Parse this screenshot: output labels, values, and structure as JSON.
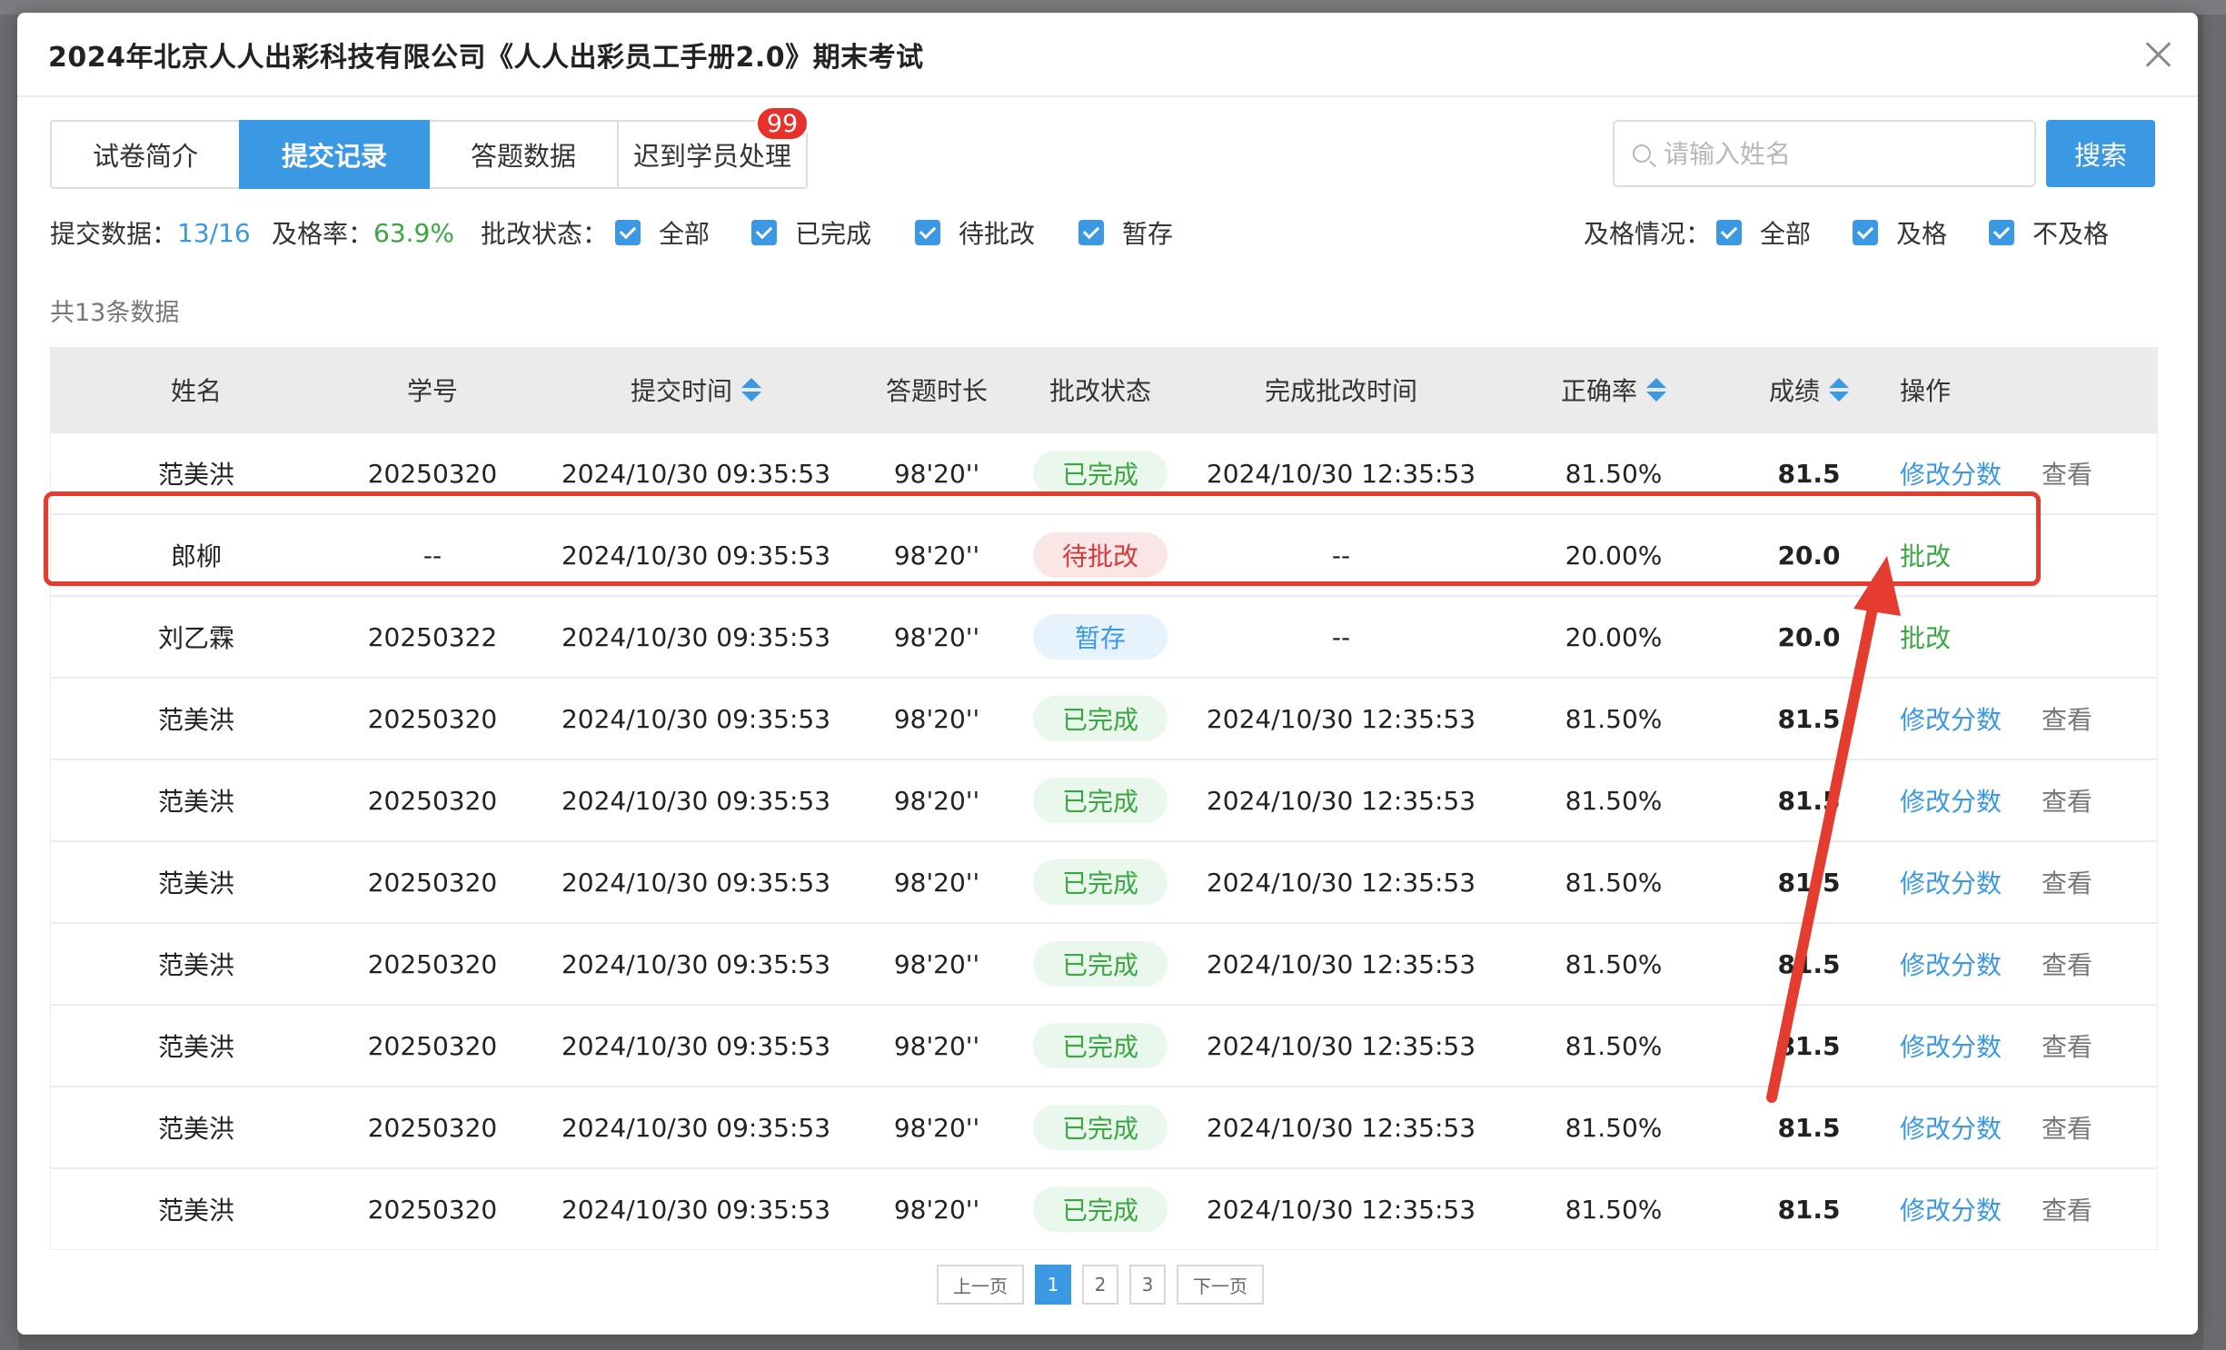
{
  "modal": {
    "title": "2024年北京人人出彩科技有限公司《人人出彩员工手册2.0》期末考试"
  },
  "tabs": [
    {
      "label": "试卷简介",
      "active": false
    },
    {
      "label": "提交记录",
      "active": true
    },
    {
      "label": "答题数据",
      "active": false
    },
    {
      "label": "迟到学员处理",
      "active": false,
      "badge": "99"
    }
  ],
  "search": {
    "placeholder": "请输入姓名",
    "value": "",
    "button_label": "搜索"
  },
  "filters": {
    "submit_label": "提交数据：",
    "submit_value": "13/16",
    "pass_rate_label": "及格率：",
    "pass_rate_value": "63.9%",
    "review_status_label": "批改状态：",
    "review_status_options": [
      {
        "label": "全部",
        "checked": true
      },
      {
        "label": "已完成",
        "checked": true
      },
      {
        "label": "待批改",
        "checked": true
      },
      {
        "label": "暂存",
        "checked": true
      }
    ],
    "pass_status_label": "及格情况：",
    "pass_status_options": [
      {
        "label": "全部",
        "checked": true
      },
      {
        "label": "及格",
        "checked": true
      },
      {
        "label": "不及格",
        "checked": true
      }
    ]
  },
  "total_text": "共13条数据",
  "table": {
    "headers": {
      "name": "姓名",
      "id": "学号",
      "submit_time": "提交时间",
      "duration": "答题时长",
      "review_status": "批改状态",
      "done_time": "完成批改时间",
      "accuracy": "正确率",
      "score": "成绩",
      "ops": "操作"
    },
    "rows": [
      {
        "name": "范美洪",
        "id": "20250320",
        "submit_time": "2024/10/30 09:35:53",
        "duration": "98'20''",
        "status": "已完成",
        "status_type": "done",
        "done_time": "2024/10/30 12:35:53",
        "accuracy": "81.50%",
        "score": "81.5",
        "ops": [
          {
            "label": "修改分数",
            "color": "blue"
          },
          {
            "label": "查看",
            "color": "gray"
          }
        ]
      },
      {
        "name": "郎柳",
        "id": "--",
        "submit_time": "2024/10/30 09:35:53",
        "duration": "98'20''",
        "status": "待批改",
        "status_type": "pending",
        "done_time": "--",
        "accuracy": "20.00%",
        "score": "20.0",
        "ops": [
          {
            "label": "批改",
            "color": "green"
          }
        ]
      },
      {
        "name": "刘乙霖",
        "id": "20250322",
        "submit_time": "2024/10/30 09:35:53",
        "duration": "98'20''",
        "status": "暂存",
        "status_type": "draft",
        "done_time": "--",
        "accuracy": "20.00%",
        "score": "20.0",
        "ops": [
          {
            "label": "批改",
            "color": "green"
          }
        ]
      },
      {
        "name": "范美洪",
        "id": "20250320",
        "submit_time": "2024/10/30 09:35:53",
        "duration": "98'20''",
        "status": "已完成",
        "status_type": "done",
        "done_time": "2024/10/30 12:35:53",
        "accuracy": "81.50%",
        "score": "81.5",
        "ops": [
          {
            "label": "修改分数",
            "color": "blue"
          },
          {
            "label": "查看",
            "color": "gray"
          }
        ]
      },
      {
        "name": "范美洪",
        "id": "20250320",
        "submit_time": "2024/10/30 09:35:53",
        "duration": "98'20''",
        "status": "已完成",
        "status_type": "done",
        "done_time": "2024/10/30 12:35:53",
        "accuracy": "81.50%",
        "score": "81.5",
        "ops": [
          {
            "label": "修改分数",
            "color": "blue"
          },
          {
            "label": "查看",
            "color": "gray"
          }
        ]
      },
      {
        "name": "范美洪",
        "id": "20250320",
        "submit_time": "2024/10/30 09:35:53",
        "duration": "98'20''",
        "status": "已完成",
        "status_type": "done",
        "done_time": "2024/10/30 12:35:53",
        "accuracy": "81.50%",
        "score": "81.5",
        "ops": [
          {
            "label": "修改分数",
            "color": "blue"
          },
          {
            "label": "查看",
            "color": "gray"
          }
        ]
      },
      {
        "name": "范美洪",
        "id": "20250320",
        "submit_time": "2024/10/30 09:35:53",
        "duration": "98'20''",
        "status": "已完成",
        "status_type": "done",
        "done_time": "2024/10/30 12:35:53",
        "accuracy": "81.50%",
        "score": "81.5",
        "ops": [
          {
            "label": "修改分数",
            "color": "blue"
          },
          {
            "label": "查看",
            "color": "gray"
          }
        ]
      },
      {
        "name": "范美洪",
        "id": "20250320",
        "submit_time": "2024/10/30 09:35:53",
        "duration": "98'20''",
        "status": "已完成",
        "status_type": "done",
        "done_time": "2024/10/30 12:35:53",
        "accuracy": "81.50%",
        "score": "81.5",
        "ops": [
          {
            "label": "修改分数",
            "color": "blue"
          },
          {
            "label": "查看",
            "color": "gray"
          }
        ]
      },
      {
        "name": "范美洪",
        "id": "20250320",
        "submit_time": "2024/10/30 09:35:53",
        "duration": "98'20''",
        "status": "已完成",
        "status_type": "done",
        "done_time": "2024/10/30 12:35:53",
        "accuracy": "81.50%",
        "score": "81.5",
        "ops": [
          {
            "label": "修改分数",
            "color": "blue"
          },
          {
            "label": "查看",
            "color": "gray"
          }
        ]
      },
      {
        "name": "范美洪",
        "id": "20250320",
        "submit_time": "2024/10/30 09:35:53",
        "duration": "98'20''",
        "status": "已完成",
        "status_type": "done",
        "done_time": "2024/10/30 12:35:53",
        "accuracy": "81.50%",
        "score": "81.5",
        "ops": [
          {
            "label": "修改分数",
            "color": "blue"
          },
          {
            "label": "查看",
            "color": "gray"
          }
        ]
      }
    ]
  },
  "pagination": {
    "prev_label": "上一页",
    "pages": [
      "1",
      "2",
      "3"
    ],
    "current_page": "1",
    "next_label": "下一页"
  },
  "colors": {
    "accent": "#3b98e3",
    "success": "#3aa743",
    "danger": "#e43c2e"
  },
  "icons": {
    "close": "close-icon",
    "search": "search-icon",
    "checkbox": "checkbox-checked-icon",
    "sort": "sort-icon"
  }
}
